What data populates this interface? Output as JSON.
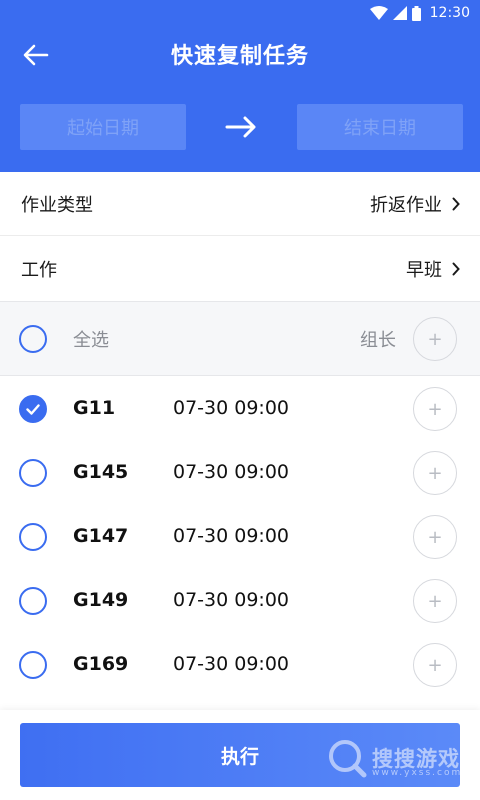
{
  "status_bar": {
    "time": "12:30"
  },
  "header": {
    "title": "快速复制任务"
  },
  "date_range": {
    "start_placeholder": "起始日期",
    "end_placeholder": "结束日期"
  },
  "settings": {
    "job_type": {
      "label": "作业类型",
      "value": "折返作业"
    },
    "work": {
      "label": "工作",
      "value": "早班"
    }
  },
  "select_all": {
    "label": "全选",
    "leader_label": "组长",
    "plus": "+"
  },
  "trains": [
    {
      "code": "G11",
      "time": "07-30 09:00",
      "checked": true,
      "plus": "+"
    },
    {
      "code": "G145",
      "time": "07-30 09:00",
      "checked": false,
      "plus": "+"
    },
    {
      "code": "G147",
      "time": "07-30 09:00",
      "checked": false,
      "plus": "+"
    },
    {
      "code": "G149",
      "time": "07-30 09:00",
      "checked": false,
      "plus": "+"
    },
    {
      "code": "G169",
      "time": "07-30 09:00",
      "checked": false,
      "plus": "+"
    }
  ],
  "footer": {
    "execute_label": "执行"
  },
  "watermark": {
    "text": "搜搜游戏",
    "url": "www.yxss.com"
  },
  "colors": {
    "primary": "#3a6cf0",
    "date_box": "#5a86f6",
    "muted": "#8a8d94"
  }
}
